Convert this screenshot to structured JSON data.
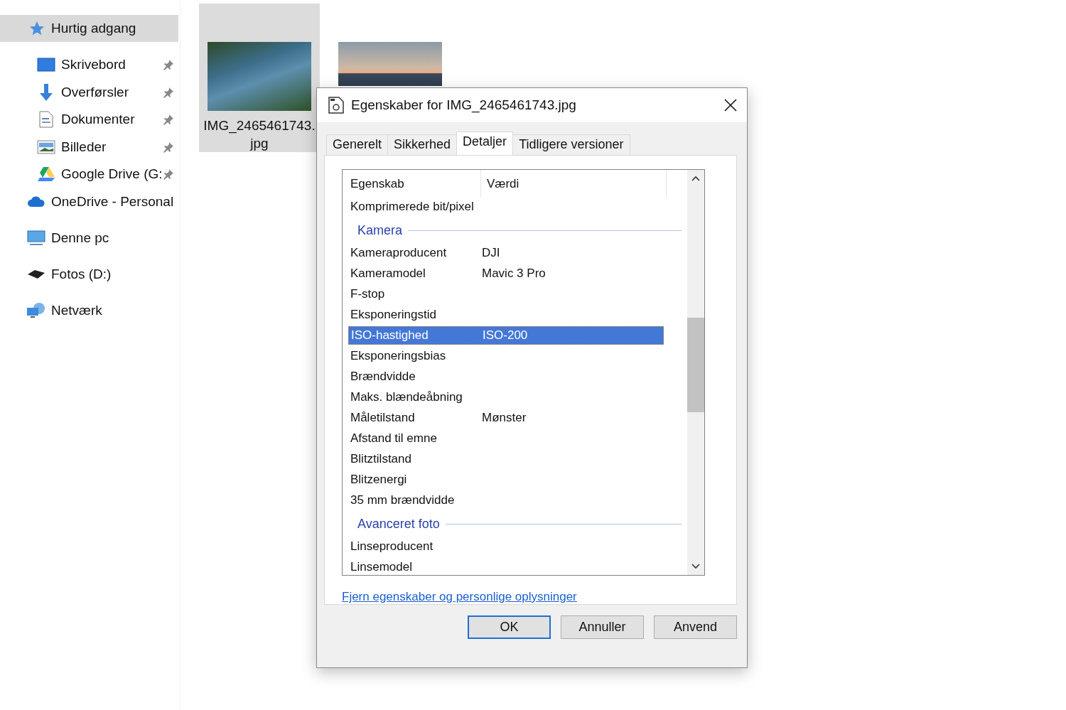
{
  "sidebar": {
    "items": [
      {
        "label": "Hurtig adgang",
        "kind": "star",
        "selected": true,
        "pinned": false,
        "children": [
          {
            "label": "Skrivebord",
            "kind": "desktop",
            "selected": false,
            "pinned": true
          },
          {
            "label": "Overførsler",
            "kind": "download",
            "selected": false,
            "pinned": true
          },
          {
            "label": "Dokumenter",
            "kind": "document",
            "selected": false,
            "pinned": true
          },
          {
            "label": "Billeder",
            "kind": "pictures",
            "selected": false,
            "pinned": true
          },
          {
            "label": "Google Drive (G:",
            "kind": "gdrive",
            "selected": false,
            "pinned": true
          }
        ]
      },
      {
        "label": "OneDrive - Personal",
        "kind": "cloud",
        "selected": false,
        "pinned": false
      },
      {
        "label": "Denne pc",
        "kind": "pc",
        "selected": false,
        "pinned": false
      },
      {
        "label": "Fotos (D:)",
        "kind": "drive",
        "selected": false,
        "pinned": false
      },
      {
        "label": "Netværk",
        "kind": "network",
        "selected": false,
        "pinned": false
      }
    ]
  },
  "files": [
    {
      "name": "IMG_2465461743.jpg",
      "kind": "aerial",
      "selected": true
    },
    {
      "kind": "sunset",
      "selected": false
    }
  ],
  "dialog": {
    "title": "Egenskaber for IMG_2465461743.jpg",
    "tabs": [
      {
        "label": "Generelt",
        "selected": false
      },
      {
        "label": "Sikkerhed",
        "selected": false
      },
      {
        "label": "Detaljer",
        "selected": true
      },
      {
        "label": "Tidligere versioner",
        "selected": false
      }
    ],
    "columns": [
      "Egenskab",
      "Værdi"
    ],
    "rows": [
      {
        "kind": "property",
        "name": "Komprimerede bit/pixel",
        "selected": false
      },
      {
        "kind": "group",
        "name": "Kamera"
      },
      {
        "kind": "property",
        "name": "Kameraproducent",
        "value": "DJI",
        "selected": false
      },
      {
        "kind": "property",
        "name": "Kameramodel",
        "value": "Mavic 3 Pro",
        "selected": false
      },
      {
        "kind": "property",
        "name": "F-stop",
        "selected": false
      },
      {
        "kind": "property",
        "name": "Eksponeringstid",
        "selected": false
      },
      {
        "kind": "property",
        "name": "ISO-hastighed",
        "value": "ISO-200",
        "selected": true
      },
      {
        "kind": "property",
        "name": "Eksponeringsbias",
        "selected": false
      },
      {
        "kind": "property",
        "name": "Brændvidde",
        "selected": false
      },
      {
        "kind": "property",
        "name": "Maks. blændeåbning",
        "selected": false
      },
      {
        "kind": "property",
        "name": "Måletilstand",
        "value": "Mønster",
        "selected": false
      },
      {
        "kind": "property",
        "name": "Afstand til emne",
        "selected": false
      },
      {
        "kind": "property",
        "name": "Blitztilstand",
        "selected": false
      },
      {
        "kind": "property",
        "name": "Blitzenergi",
        "selected": false
      },
      {
        "kind": "property",
        "name": "35 mm brændvidde",
        "selected": false
      },
      {
        "kind": "group",
        "name": "Avanceret foto"
      },
      {
        "kind": "property",
        "name": "Linseproducent",
        "selected": false
      },
      {
        "kind": "property",
        "name": "Linsemodel",
        "selected": false
      }
    ],
    "link": "Fjern egenskaber og personlige oplysninger",
    "buttons": [
      {
        "label": "OK",
        "default": true
      },
      {
        "label": "Annuller",
        "default": false
      },
      {
        "label": "Anvend",
        "default": false
      }
    ]
  }
}
